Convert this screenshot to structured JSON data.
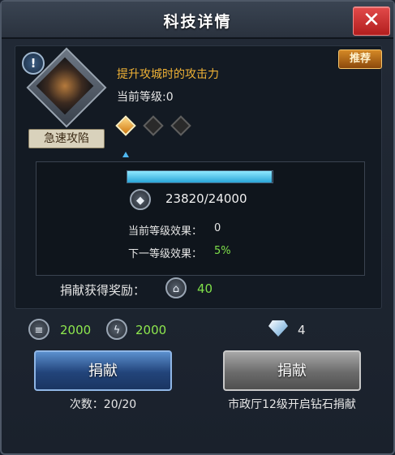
{
  "dialog": {
    "title": "科技详情",
    "close_label": "✕"
  },
  "tech": {
    "name": "急速攻陷",
    "description": "提升攻城时的攻击力",
    "current_level_text": "当前等级:0",
    "recommend_badge": "推荐",
    "levels_total": 3,
    "levels_reached": 1
  },
  "progress": {
    "text": "23820/24000",
    "fraction": 0.9925
  },
  "effects": {
    "current_label": "当前等级效果：",
    "current_value": "0",
    "next_label": "下一等级效果：",
    "next_value": "5%"
  },
  "reward": {
    "label": "捐献获得奖励：",
    "value": "40"
  },
  "costs": {
    "resource_1": "2000",
    "resource_2": "2000",
    "gems": "4"
  },
  "buttons": {
    "donate_left": "捐献",
    "donate_right": "捐献",
    "count_text": "次数：20/20",
    "locked_text": "市政厅12级开启钻石捐献"
  },
  "colors": {
    "accent_orange": "#f0b235",
    "value_green": "#7fe04a",
    "progress_blue": "#2aa6d8",
    "close_red": "#c62828"
  },
  "icons": [
    "info-icon",
    "medal-icon",
    "coin-icon",
    "lightning-icon",
    "diamond-icon",
    "close-icon"
  ]
}
